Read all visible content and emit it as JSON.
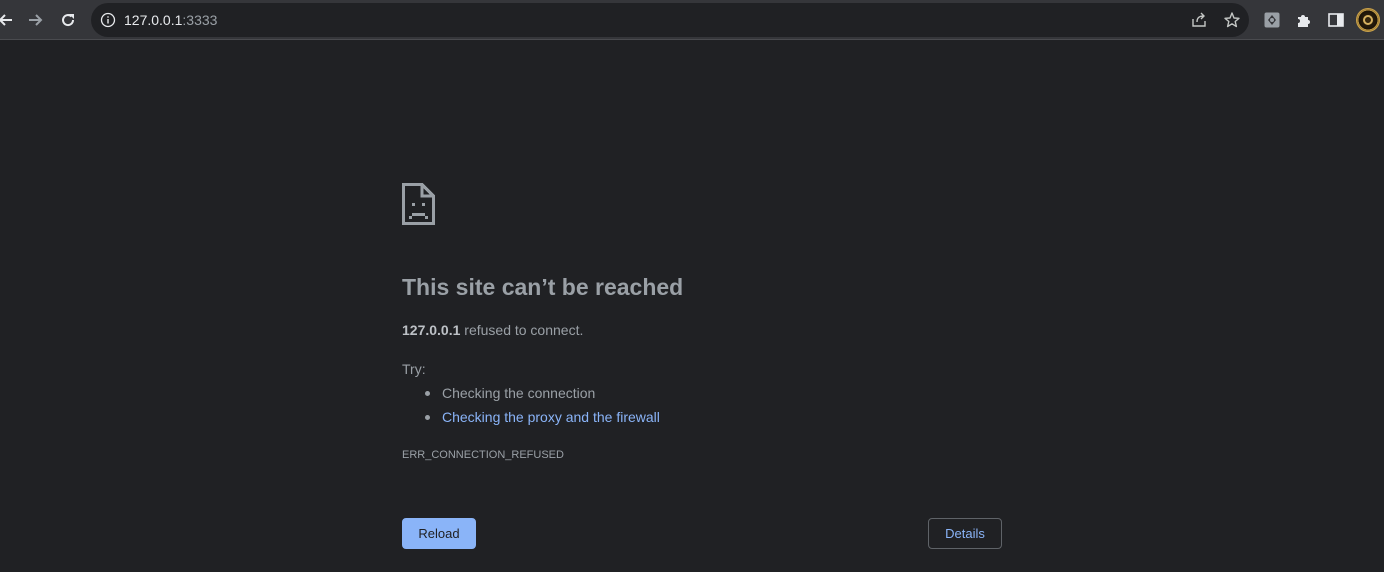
{
  "browser": {
    "url_host": "127.0.0.1",
    "url_port": ":3333",
    "icons": {
      "back": "back-arrow-icon",
      "forward": "forward-arrow-icon",
      "reload": "reload-icon",
      "info": "info-icon",
      "share": "share-icon",
      "bookmark": "star-icon",
      "extension_app": "extension-app-icon",
      "extensions": "puzzle-icon",
      "side_panel": "side-panel-icon",
      "profile": "profile-avatar"
    }
  },
  "error_page": {
    "title": "This site can’t be reached",
    "host": "127.0.0.1",
    "message": " refused to connect.",
    "try_label": "Try:",
    "suggestions": [
      {
        "text": "Checking the connection",
        "is_link": false
      },
      {
        "text": "Checking the proxy and the firewall",
        "is_link": true
      }
    ],
    "error_code": "ERR_CONNECTION_REFUSED",
    "reload_label": "Reload",
    "details_label": "Details"
  },
  "colors": {
    "background": "#202124",
    "toolbar": "#35363a",
    "text": "#9aa0a6",
    "link": "#8ab4f8"
  }
}
